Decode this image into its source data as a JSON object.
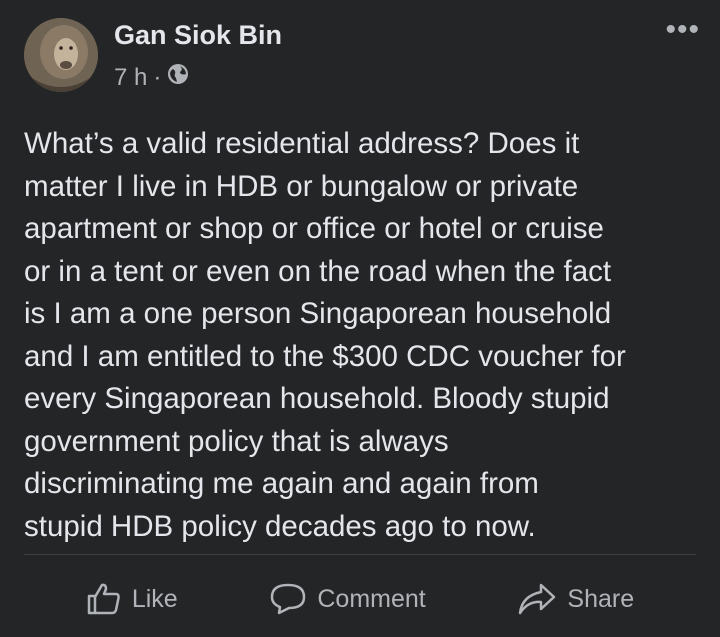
{
  "post": {
    "author": "Gan Siok Bin",
    "time": "7 h",
    "separator": "·",
    "text": "What’s a valid residential address? Does it\nmatter I live in HDB or bungalow or private\napartment or shop or office or hotel or cruise\nor in a tent or even on the road when the fact\nis I am a one person Singaporean household\nand I am entitled to the $300 CDC voucher for\nevery Singaporean household. Bloody stupid\ngovernment policy that is always\ndiscriminating me again and again from\nstupid HDB policy decades ago to now.",
    "more_icon": "•••"
  },
  "actions": {
    "like_label": "Like",
    "comment_label": "Comment",
    "share_label": "Share"
  },
  "icons": {
    "avatar": "lion-avatar",
    "privacy": "globe-icon",
    "more": "more-options-icon",
    "like": "thumbs-up-icon",
    "comment": "speech-bubble-icon",
    "share": "share-arrow-icon"
  }
}
